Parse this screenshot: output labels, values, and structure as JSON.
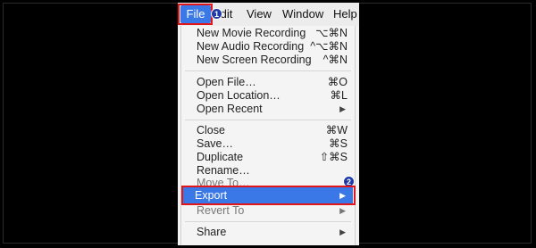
{
  "menubar": {
    "file_label": "File",
    "edit_label": "Edit",
    "view_label": "View",
    "window_label": "Window",
    "help_label": "Help"
  },
  "badges": {
    "step1": "1",
    "step2": "2"
  },
  "file_menu": {
    "groups": [
      [
        {
          "label": "New Movie Recording",
          "shortcut": "⌥⌘N"
        },
        {
          "label": "New Audio Recording",
          "shortcut": "^⌥⌘N"
        },
        {
          "label": "New Screen Recording",
          "shortcut": "^⌘N"
        }
      ],
      [
        {
          "label": "Open File…",
          "shortcut": "⌘O"
        },
        {
          "label": "Open Location…",
          "shortcut": "⌘L"
        },
        {
          "label": "Open Recent",
          "shortcut": "▶"
        }
      ],
      [
        {
          "label": "Close",
          "shortcut": "⌘W"
        },
        {
          "label": "Save…",
          "shortcut": "⌘S"
        },
        {
          "label": "Duplicate",
          "shortcut": "⇧⌘S"
        },
        {
          "label": "Rename…",
          "shortcut": ""
        },
        {
          "label": "Move To…",
          "shortcut": ""
        },
        {
          "label": "Export",
          "shortcut": "▶"
        },
        {
          "label": "Revert To",
          "shortcut": "▶"
        }
      ],
      [
        {
          "label": "Share",
          "shortcut": "▶"
        }
      ]
    ]
  },
  "colors": {
    "highlight_blue": "#3b78e7",
    "annotation_red": "#e0161b",
    "badge_blue": "#1d3aa8"
  }
}
